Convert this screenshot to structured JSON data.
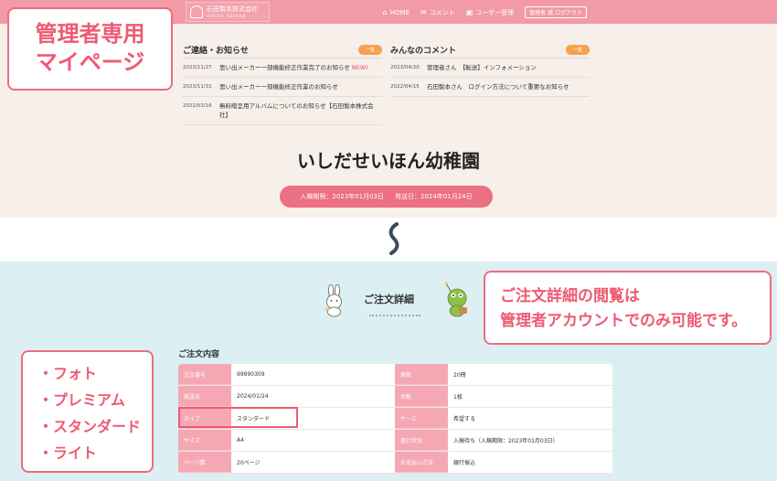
{
  "header": {
    "logo_name": "石田製本株式会社",
    "logo_sub": "ISHIDA SEIHON",
    "nav": [
      {
        "icon": "home-icon",
        "glyph": "⌂",
        "label": "HOME"
      },
      {
        "icon": "comment-icon",
        "glyph": "✉",
        "label": "コメント"
      },
      {
        "icon": "user-icon",
        "glyph": "▣",
        "label": "ユーザー管理"
      }
    ],
    "admin_label": "管理者 様",
    "logout_label": "ログアウト"
  },
  "annotations": {
    "mypage_line1": "管理者専用",
    "mypage_line2": "マイページ",
    "order_line1": "ご注文詳細の閲覧は",
    "order_line2": "管理者アカウントでのみ可能です。",
    "types": [
      "・フォト",
      "・プレミアム",
      "・スタンダード",
      "・ライト"
    ]
  },
  "news": {
    "title": "ご連絡・お知らせ",
    "more": "一覧",
    "items": [
      {
        "date": "2023/11/27",
        "text": "思い出メーカー一部機能修正作業完了のお知らせ",
        "badge": "NEW!"
      },
      {
        "date": "2023/11/31",
        "text": "思い出メーカー一部機能修正作業のお知らせ",
        "badge": ""
      },
      {
        "date": "2022/03/16",
        "text": "無料贈呈用アルバムについてのお知らせ【石田製本株式会社】",
        "badge": ""
      }
    ]
  },
  "comments": {
    "title": "みんなのコメント",
    "more": "一覧",
    "items": [
      {
        "date": "2023/04/20",
        "text": "管理者さん　【転送】インフォメーション"
      },
      {
        "date": "2022/04/15",
        "text": "石田製本さん　ログイン方法について重要なお知らせ"
      }
    ]
  },
  "school": {
    "name": "いしだせいほん幼稚園",
    "enroll": "入稿期限：2023年01月03日",
    "ship": "発送日：2024年01月24日"
  },
  "order_detail": {
    "title": "ご注文詳細",
    "section": "ご注文内容",
    "rows": [
      {
        "l1": "注文番号",
        "v1": "99990309",
        "l2": "冊数",
        "v2": "20冊"
      },
      {
        "l1": "発送日",
        "v1": "2024/01/24",
        "l2": "台紙",
        "v2": "1枚"
      },
      {
        "l1": "タイプ",
        "v1": "スタンダード",
        "l2": "ケース",
        "v2": "希望する"
      },
      {
        "l1": "サイズ",
        "v1": "A4",
        "l2": "進行状況",
        "v2": "入稿待ち（入稿期限：2023年01月03日）"
      },
      {
        "l1": "ページ数",
        "v1": "20ページ",
        "l2": "お支払い方法",
        "v2": "銀行振込"
      }
    ]
  }
}
